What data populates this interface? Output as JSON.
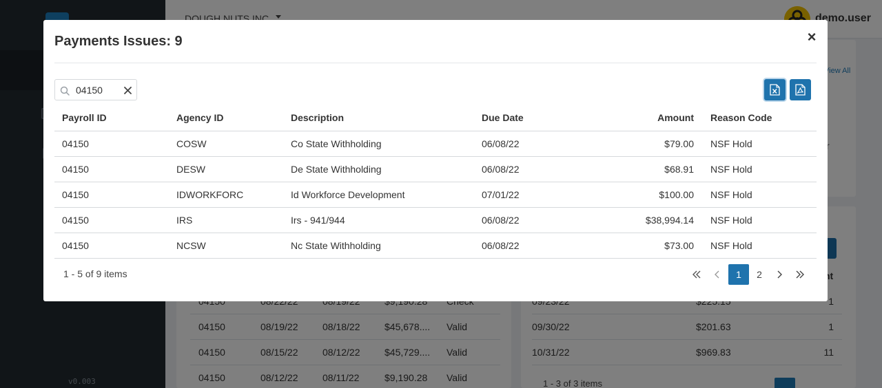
{
  "app": {
    "company": "DOUGH NUTS INC",
    "user": "demo.user",
    "version": "v0.003",
    "view_all_label": "View All",
    "accent_color": "#1f73ad"
  },
  "background_tables": {
    "left_rows": [
      [
        "04150",
        "08/22/22",
        "08/19/22",
        "$9,190.28",
        "Check"
      ],
      [
        "04150",
        "08/19/22",
        "08/18/22",
        "$45,678....",
        "Valid"
      ],
      [
        "04150",
        "08/15/22",
        "08/12/22",
        "$45,729....",
        "Valid"
      ],
      [
        "04150",
        "08/12/22",
        "08/11/22",
        "$9,190.28",
        "Valid"
      ]
    ],
    "right_header_fragment": "nt",
    "right_rows": [
      [
        "09/23/22",
        "$225.15",
        "1"
      ],
      [
        "09/30/22",
        "$201.63",
        "1"
      ],
      [
        "10/31/22",
        "$969.83",
        "11"
      ]
    ],
    "right_pager": "1 - 3 of 3 items",
    "right_pager_page": "1",
    "card_fragment": "r"
  },
  "modal": {
    "title": "Payments Issues: 9",
    "close_glyph": "×",
    "search": {
      "value": "04150",
      "placeholder": ""
    },
    "export_excel_label": "Export to Excel",
    "export_pdf_label": "Export to PDF",
    "columns": {
      "payroll_id": "Payroll ID",
      "agency_id": "Agency ID",
      "description": "Description",
      "due_date": "Due Date",
      "amount": "Amount",
      "reason_code": "Reason Code"
    },
    "rows": [
      {
        "payroll_id": "04150",
        "agency_id": "COSW",
        "description": "Co State Withholding",
        "due_date": "06/08/22",
        "amount": "$79.00",
        "reason_code": "NSF Hold"
      },
      {
        "payroll_id": "04150",
        "agency_id": "DESW",
        "description": "De State Withholding",
        "due_date": "06/08/22",
        "amount": "$68.91",
        "reason_code": "NSF Hold"
      },
      {
        "payroll_id": "04150",
        "agency_id": "IDWORKFORC",
        "description": "Id Workforce Development",
        "due_date": "07/01/22",
        "amount": "$100.00",
        "reason_code": "NSF Hold"
      },
      {
        "payroll_id": "04150",
        "agency_id": "IRS",
        "description": "Irs - 941/944",
        "due_date": "06/08/22",
        "amount": "$38,994.14",
        "reason_code": "NSF Hold"
      },
      {
        "payroll_id": "04150",
        "agency_id": "NCSW",
        "description": "Nc State Withholding",
        "due_date": "06/08/22",
        "amount": "$73.00",
        "reason_code": "NSF Hold"
      }
    ],
    "pager": {
      "info": "1 - 5 of 9 items",
      "pages": [
        "1",
        "2"
      ],
      "current_page": "1"
    }
  }
}
